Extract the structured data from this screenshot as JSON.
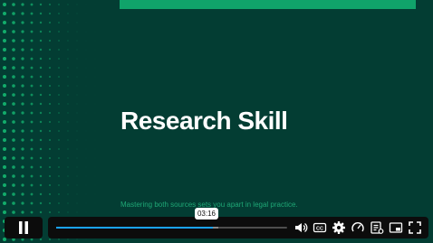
{
  "slide": {
    "title": "Research Skill",
    "subtitle": "Mastering both sources sets you apart in legal practice.",
    "colors": {
      "background": "#033d33",
      "accent": "#10a36a",
      "subtitle": "#1fa876"
    }
  },
  "player": {
    "icons": {
      "play_pause": "pause-icon",
      "volume": "volume-icon",
      "captions": "captions-icon",
      "settings": "gear-icon",
      "speed": "speed-icon",
      "transcript": "transcript-icon",
      "pip": "picture-in-picture-icon",
      "fullscreen": "fullscreen-icon"
    },
    "seek_tooltip": "03:16",
    "progress_fraction": 0.68,
    "buffered_fraction": 0.7,
    "accent_color": "#1aa3ff"
  }
}
